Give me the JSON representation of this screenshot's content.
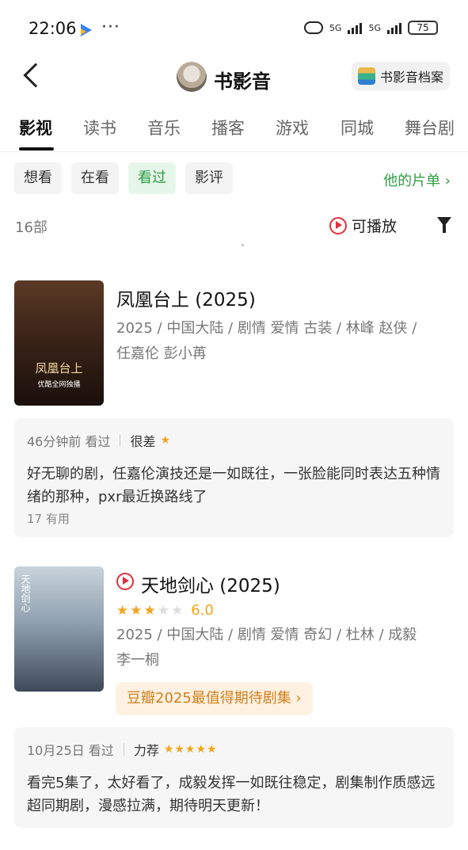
{
  "status_bar": {
    "time": "22:06",
    "battery": "75",
    "network": "5G"
  },
  "nav": {
    "title": "书影音",
    "archive_label": "书影音档案"
  },
  "tabs": [
    "影视",
    "读书",
    "音乐",
    "播客",
    "游戏",
    "同城",
    "舞台剧"
  ],
  "filters": {
    "chips": [
      "想看",
      "在看",
      "看过",
      "影评"
    ],
    "active": "看过",
    "list_link": "他的片单"
  },
  "summary": {
    "count": "16部",
    "playable_label": "可播放"
  },
  "items": [
    {
      "title": "凤凰台上 (2025)",
      "meta_line1": "2025 / 中国大陆 / 剧情 爱情 古装 / 林峰 赵侠 /",
      "meta_line2": "任嘉伦 彭小苒",
      "poster_text": "凤凰台上",
      "poster_sub": "优酷全网独播",
      "review": {
        "time": "46分钟前 看过",
        "verdict": "很差",
        "stars": "★",
        "body": "好无聊的剧，任嘉伦演技还是一如既往，一张脸能同时表达五种情绪的那种，pxr最近换路线了",
        "useful": "17 有用"
      }
    },
    {
      "title": "天地剑心 (2025)",
      "rating_value": "6.0",
      "rating_stars": 3,
      "meta_line1": "2025 / 中国大陆 / 剧情 爱情 奇幻 / 杜林 / 成毅",
      "meta_line2": "李一桐",
      "poster_text": "天地剑心",
      "badge": "豆瓣2025最值得期待剧集",
      "review": {
        "time": "10月25日 看过",
        "verdict": "力荐",
        "stars": "★★★★★",
        "body": "看完5集了，太好看了，成毅发挥一如既往稳定，剧集制作质感远超同期剧，漫感拉满，期待明天更新！"
      }
    }
  ],
  "colors": {
    "accent_green": "#2f9e44",
    "play_red": "#e0303a",
    "star_orange": "#f4a419"
  }
}
